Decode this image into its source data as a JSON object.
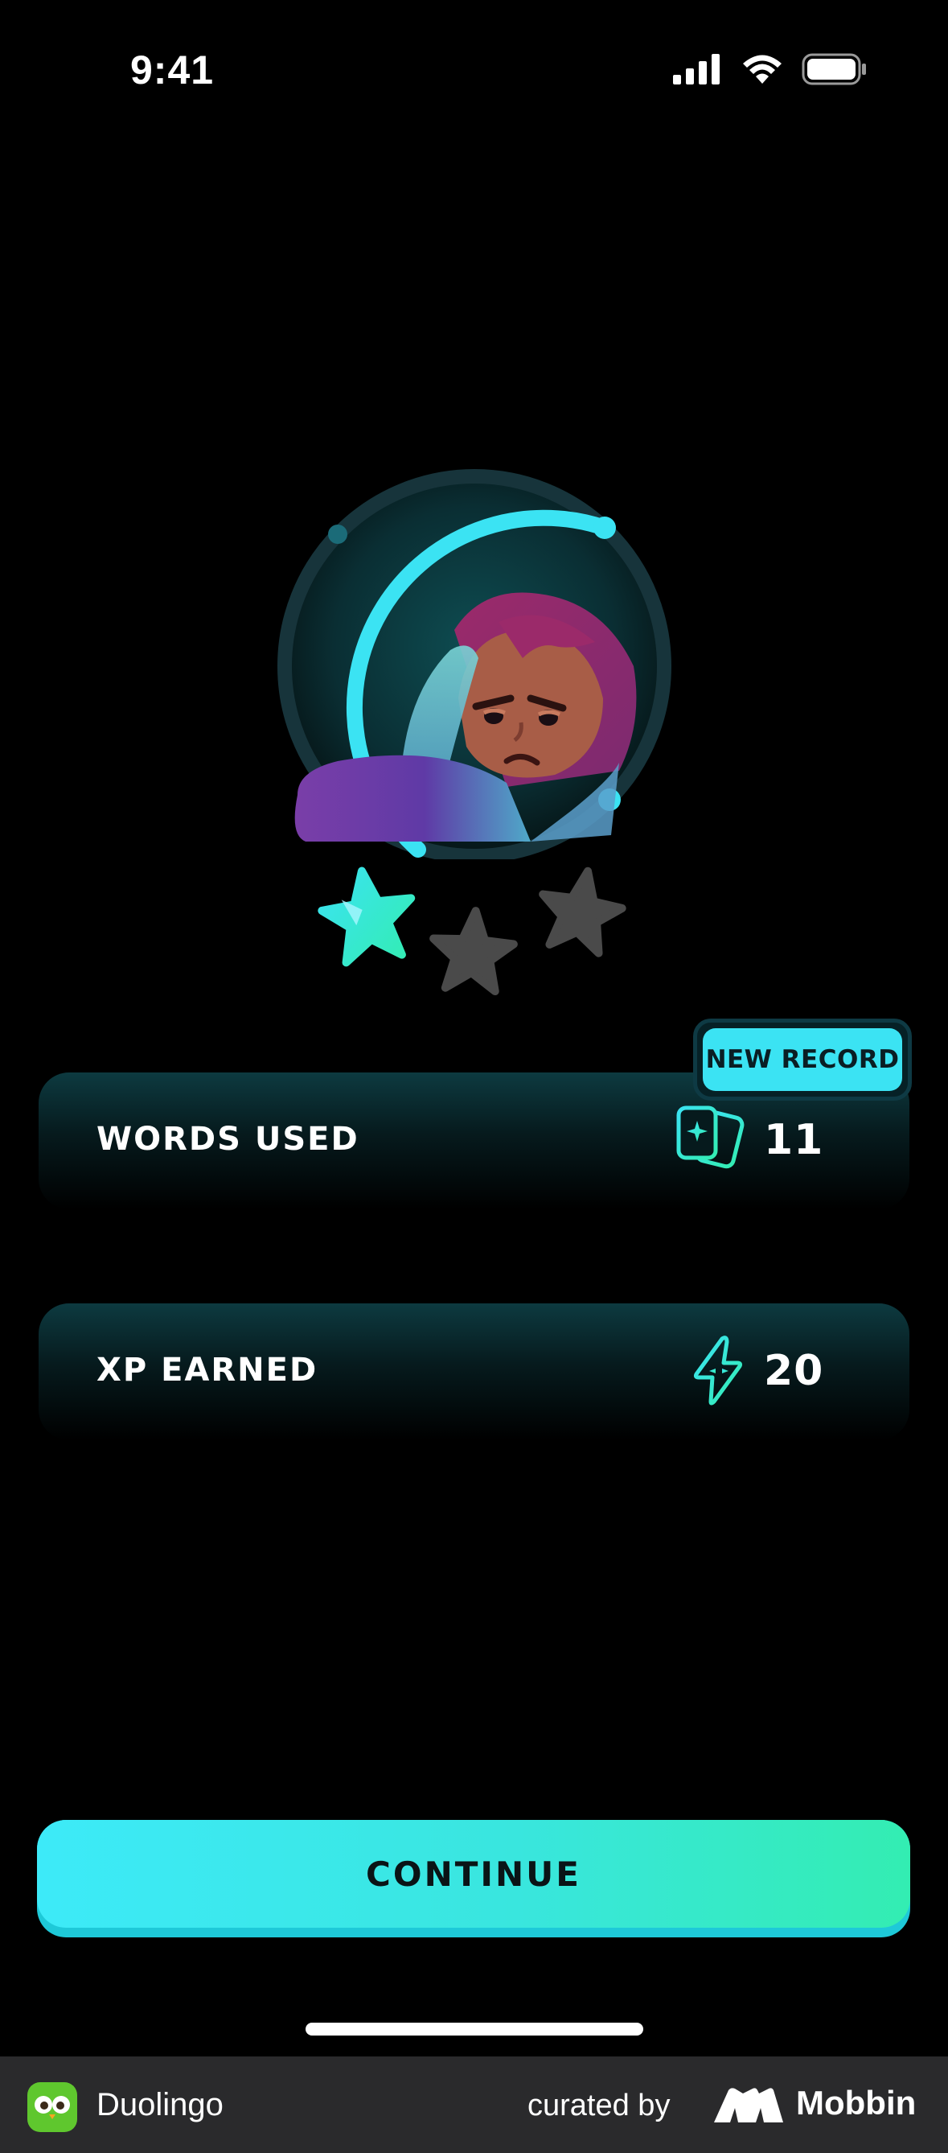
{
  "status_bar": {
    "time": "9:41"
  },
  "stats": {
    "words_used": {
      "label": "WORDS USED",
      "value": "11",
      "icon": "flashcards-icon"
    },
    "xp_earned": {
      "label": "XP EARNED",
      "value": "20",
      "icon": "lightning-bolt-icon"
    }
  },
  "badge": {
    "label": "NEW RECORD"
  },
  "rating": {
    "stars_earned": 1,
    "stars_total": 3
  },
  "continue_label": "CONTINUE",
  "footer": {
    "app_name": "Duolingo",
    "curated_by": "curated by",
    "brand": "Mobbin"
  },
  "colors": {
    "accent": "#3BE3F3",
    "accent_green": "#33EDB2",
    "character_hair": "#9B2A6A",
    "star_inactive": "#4A4A4A"
  }
}
